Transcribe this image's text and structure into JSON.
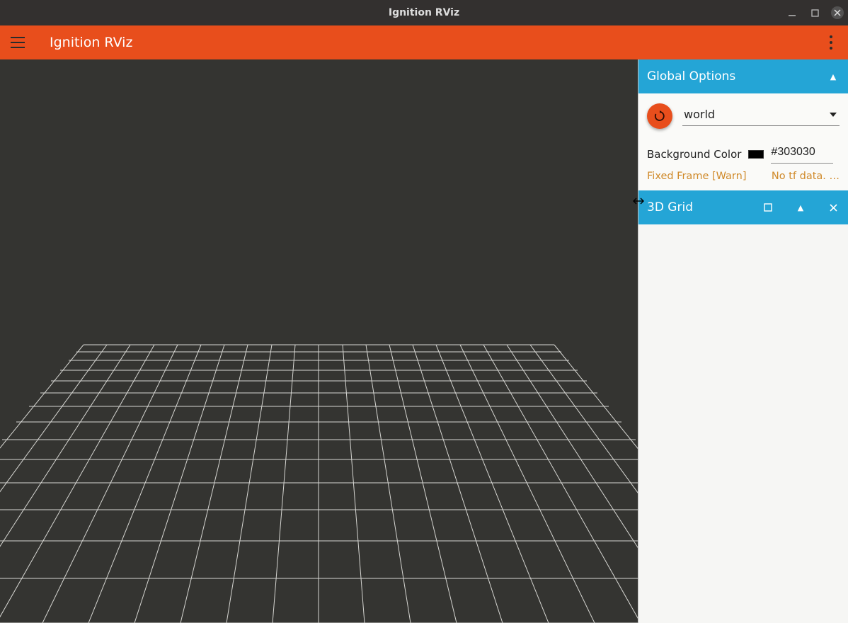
{
  "window": {
    "title": "Ignition RViz"
  },
  "header": {
    "app_title": "Ignition RViz"
  },
  "sidebar": {
    "global_options": {
      "header": "Global Options",
      "frame_value": "world",
      "bg_label": "Background Color",
      "bg_value": "#303030",
      "warn_label": "Fixed Frame [Warn]",
      "warn_text": "No tf data. …"
    },
    "grid_panel": {
      "header": "3D Grid"
    }
  },
  "colors": {
    "accent": "#e84e1c",
    "section": "#24a5d6",
    "viewport_bg": "#343431"
  }
}
